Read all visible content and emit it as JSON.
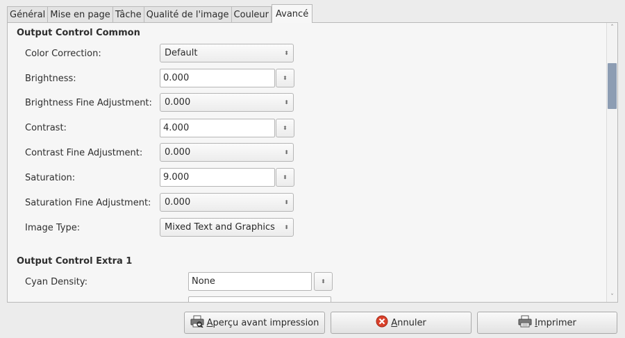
{
  "tabs": [
    {
      "label": "Général",
      "active": false
    },
    {
      "label": "Mise en page",
      "active": false
    },
    {
      "label": "Tâche",
      "active": false
    },
    {
      "label": "Qualité de l'image",
      "active": false
    },
    {
      "label": "Couleur",
      "active": false
    },
    {
      "label": "Avancé",
      "active": true
    }
  ],
  "sections": {
    "common": {
      "title": "Output Control Common",
      "fields": [
        {
          "label": "Color Correction:",
          "kind": "combo",
          "value": "Default"
        },
        {
          "label": "Brightness:",
          "kind": "spin",
          "value": "0.000"
        },
        {
          "label": "Brightness Fine Adjustment:",
          "kind": "combo",
          "value": "0.000"
        },
        {
          "label": "Contrast:",
          "kind": "spin",
          "value": "4.000"
        },
        {
          "label": "Contrast Fine Adjustment:",
          "kind": "combo",
          "value": "0.000"
        },
        {
          "label": "Saturation:",
          "kind": "spin",
          "value": "9.000"
        },
        {
          "label": "Saturation Fine Adjustment:",
          "kind": "combo",
          "value": "0.000"
        },
        {
          "label": "Image Type:",
          "kind": "combo",
          "value": "Mixed Text and Graphics"
        }
      ]
    },
    "extra1": {
      "title": "Output Control Extra 1",
      "fields": [
        {
          "label": "Cyan Density:",
          "kind": "spin",
          "value": "None"
        },
        {
          "label": "",
          "kind": "spin",
          "value": ""
        }
      ]
    }
  },
  "buttons": {
    "preview": {
      "pre": "",
      "mnemonic": "A",
      "post": "perçu avant impression",
      "icon": "print-preview-icon"
    },
    "cancel": {
      "pre": "",
      "mnemonic": "A",
      "post": "nnuler",
      "icon": "cancel-icon"
    },
    "print": {
      "pre": "",
      "mnemonic": "I",
      "post": "mprimer",
      "icon": "printer-icon"
    }
  },
  "colors": {
    "scroll_thumb": "#8d9db3",
    "cancel_icon": "#d9412b"
  }
}
